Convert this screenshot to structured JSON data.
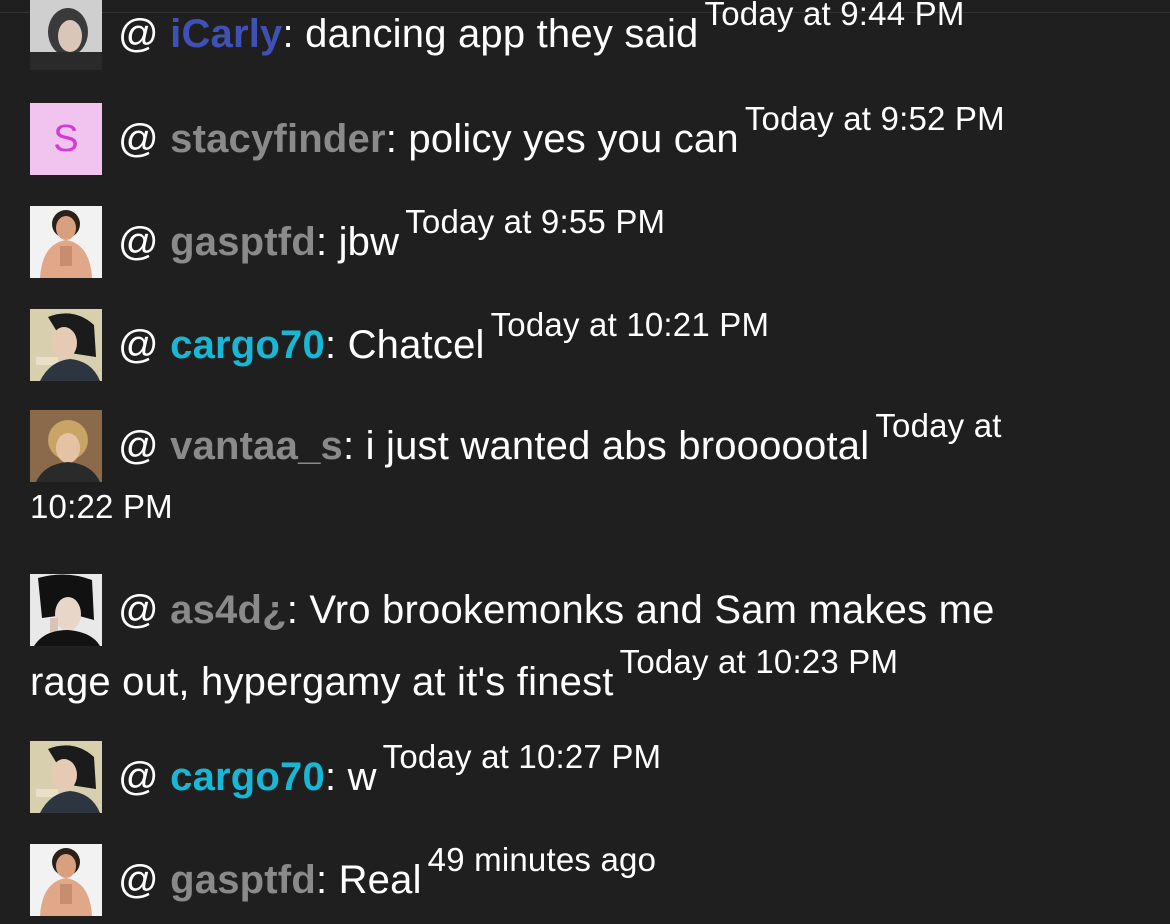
{
  "messages": [
    {
      "user": "iCarly",
      "text": ": dancing app they said",
      "time": "Today at 9:44 PM",
      "color": "#3f51b5",
      "avatar": "photo-icarly"
    },
    {
      "user": "stacyfinder",
      "text": ": policy yes you can",
      "time": "Today at 9:52 PM",
      "color": "#8a8a8a",
      "avatar_letter": "S"
    },
    {
      "user": "gasptfd",
      "text": ": jbw",
      "time": "Today at 9:55 PM",
      "color": "#8a8a8a",
      "avatar": "photo-gasptfd"
    },
    {
      "user": "cargo70",
      "text": ": Chatcel",
      "time": "Today at 10:21 PM",
      "color": "#17b8d6",
      "avatar": "photo-cargo70"
    },
    {
      "user": "vantaa_s",
      "text": ": i just wanted abs broooотal",
      "time": "Today at",
      "time_cont": "10:22 PM",
      "color": "#8a8a8a",
      "avatar": "photo-vantaa"
    },
    {
      "user": "as4d¿",
      "text": ": Vro brookemonks and Sam makes me",
      "text_cont": "rage out, hypergamy at it's finest",
      "time": "Today at 10:23 PM",
      "color": "#8a8a8a",
      "avatar": "photo-as4d"
    },
    {
      "user": "cargo70",
      "text": ": w",
      "time": "Today at 10:27 PM",
      "color": "#17b8d6",
      "avatar": "photo-cargo70"
    },
    {
      "user": "gasptfd",
      "text": ": Real",
      "time": "49 minutes ago",
      "color": "#8a8a8a",
      "avatar": "photo-gasptfd"
    }
  ],
  "at_symbol": "@ "
}
